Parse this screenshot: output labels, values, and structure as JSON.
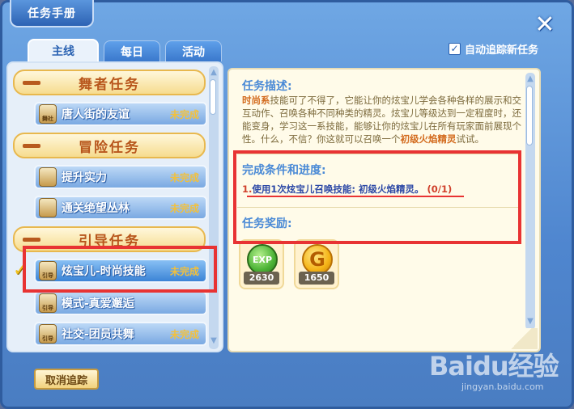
{
  "window": {
    "title": "任务手册"
  },
  "tabs": [
    {
      "label": "主线",
      "active": true
    },
    {
      "label": "每日",
      "active": false
    },
    {
      "label": "活动",
      "active": false
    }
  ],
  "auto_track": {
    "label": "自动追踪新任务",
    "checked": true
  },
  "task_list": {
    "categories": [
      {
        "label": "舞者任务"
      },
      {
        "label": "冒险任务"
      },
      {
        "label": "引导任务"
      }
    ],
    "items": [
      {
        "name": "唐人街的友谊",
        "status": "未完成",
        "icon_text": "舞社",
        "icon": "dancer-badge-icon"
      },
      {
        "name": "提升实力",
        "status": "未完成",
        "icon_text": "",
        "icon": "scroll-badge-icon"
      },
      {
        "name": "通关绝望丛林",
        "status": "未完成",
        "icon_text": "",
        "icon": "scroll-badge-icon"
      },
      {
        "name": "炫宝儿-时尚技能",
        "status": "未完成",
        "icon_text": "引导",
        "icon": "guide-badge-icon",
        "selected": true
      },
      {
        "name": "模式-真爱邂逅",
        "status": "",
        "icon_text": "引导",
        "icon": "guide-badge-icon"
      },
      {
        "name": "社交-团员共舞",
        "status": "未完成",
        "icon_text": "引导",
        "icon": "guide-badge-icon"
      }
    ]
  },
  "detail": {
    "description_title": "任务描述:",
    "description_hl1": "时尚系",
    "description_body": "技能可了不得了，它能让你的炫宝儿学会各种各样的展示和交互动作、召唤各种不同种类的精灵。炫宝儿等级达到一定程度时，还能变身，学习这一系技能，能够让你的炫宝儿在所有玩家面前展现个性。什么，不信？你这就可以召唤一个",
    "description_hl2": "初级火焰精灵",
    "description_tail": "试试。",
    "condition_title": "完成条件和进度:",
    "condition_num": "1.",
    "condition_text": "使用1次炫宝儿召唤技能: 初级火焰精灵。",
    "condition_progress": "(0/1)",
    "reward_title": "任务奖励:",
    "rewards": [
      {
        "type": "EXP",
        "amount": "2630",
        "icon": "exp-coin-icon"
      },
      {
        "type": "G",
        "amount": "1650",
        "icon": "gold-coin-icon"
      }
    ]
  },
  "footer": {
    "cancel_label": "取消追踪"
  },
  "watermark": {
    "logo": "Baidu经验",
    "sub": "jingyan.baidu.com"
  },
  "colors": {
    "accent": "#4a8ad6",
    "highlight_box": "#e83333",
    "category_text": "#b8561c",
    "status": "#f3c03a"
  }
}
